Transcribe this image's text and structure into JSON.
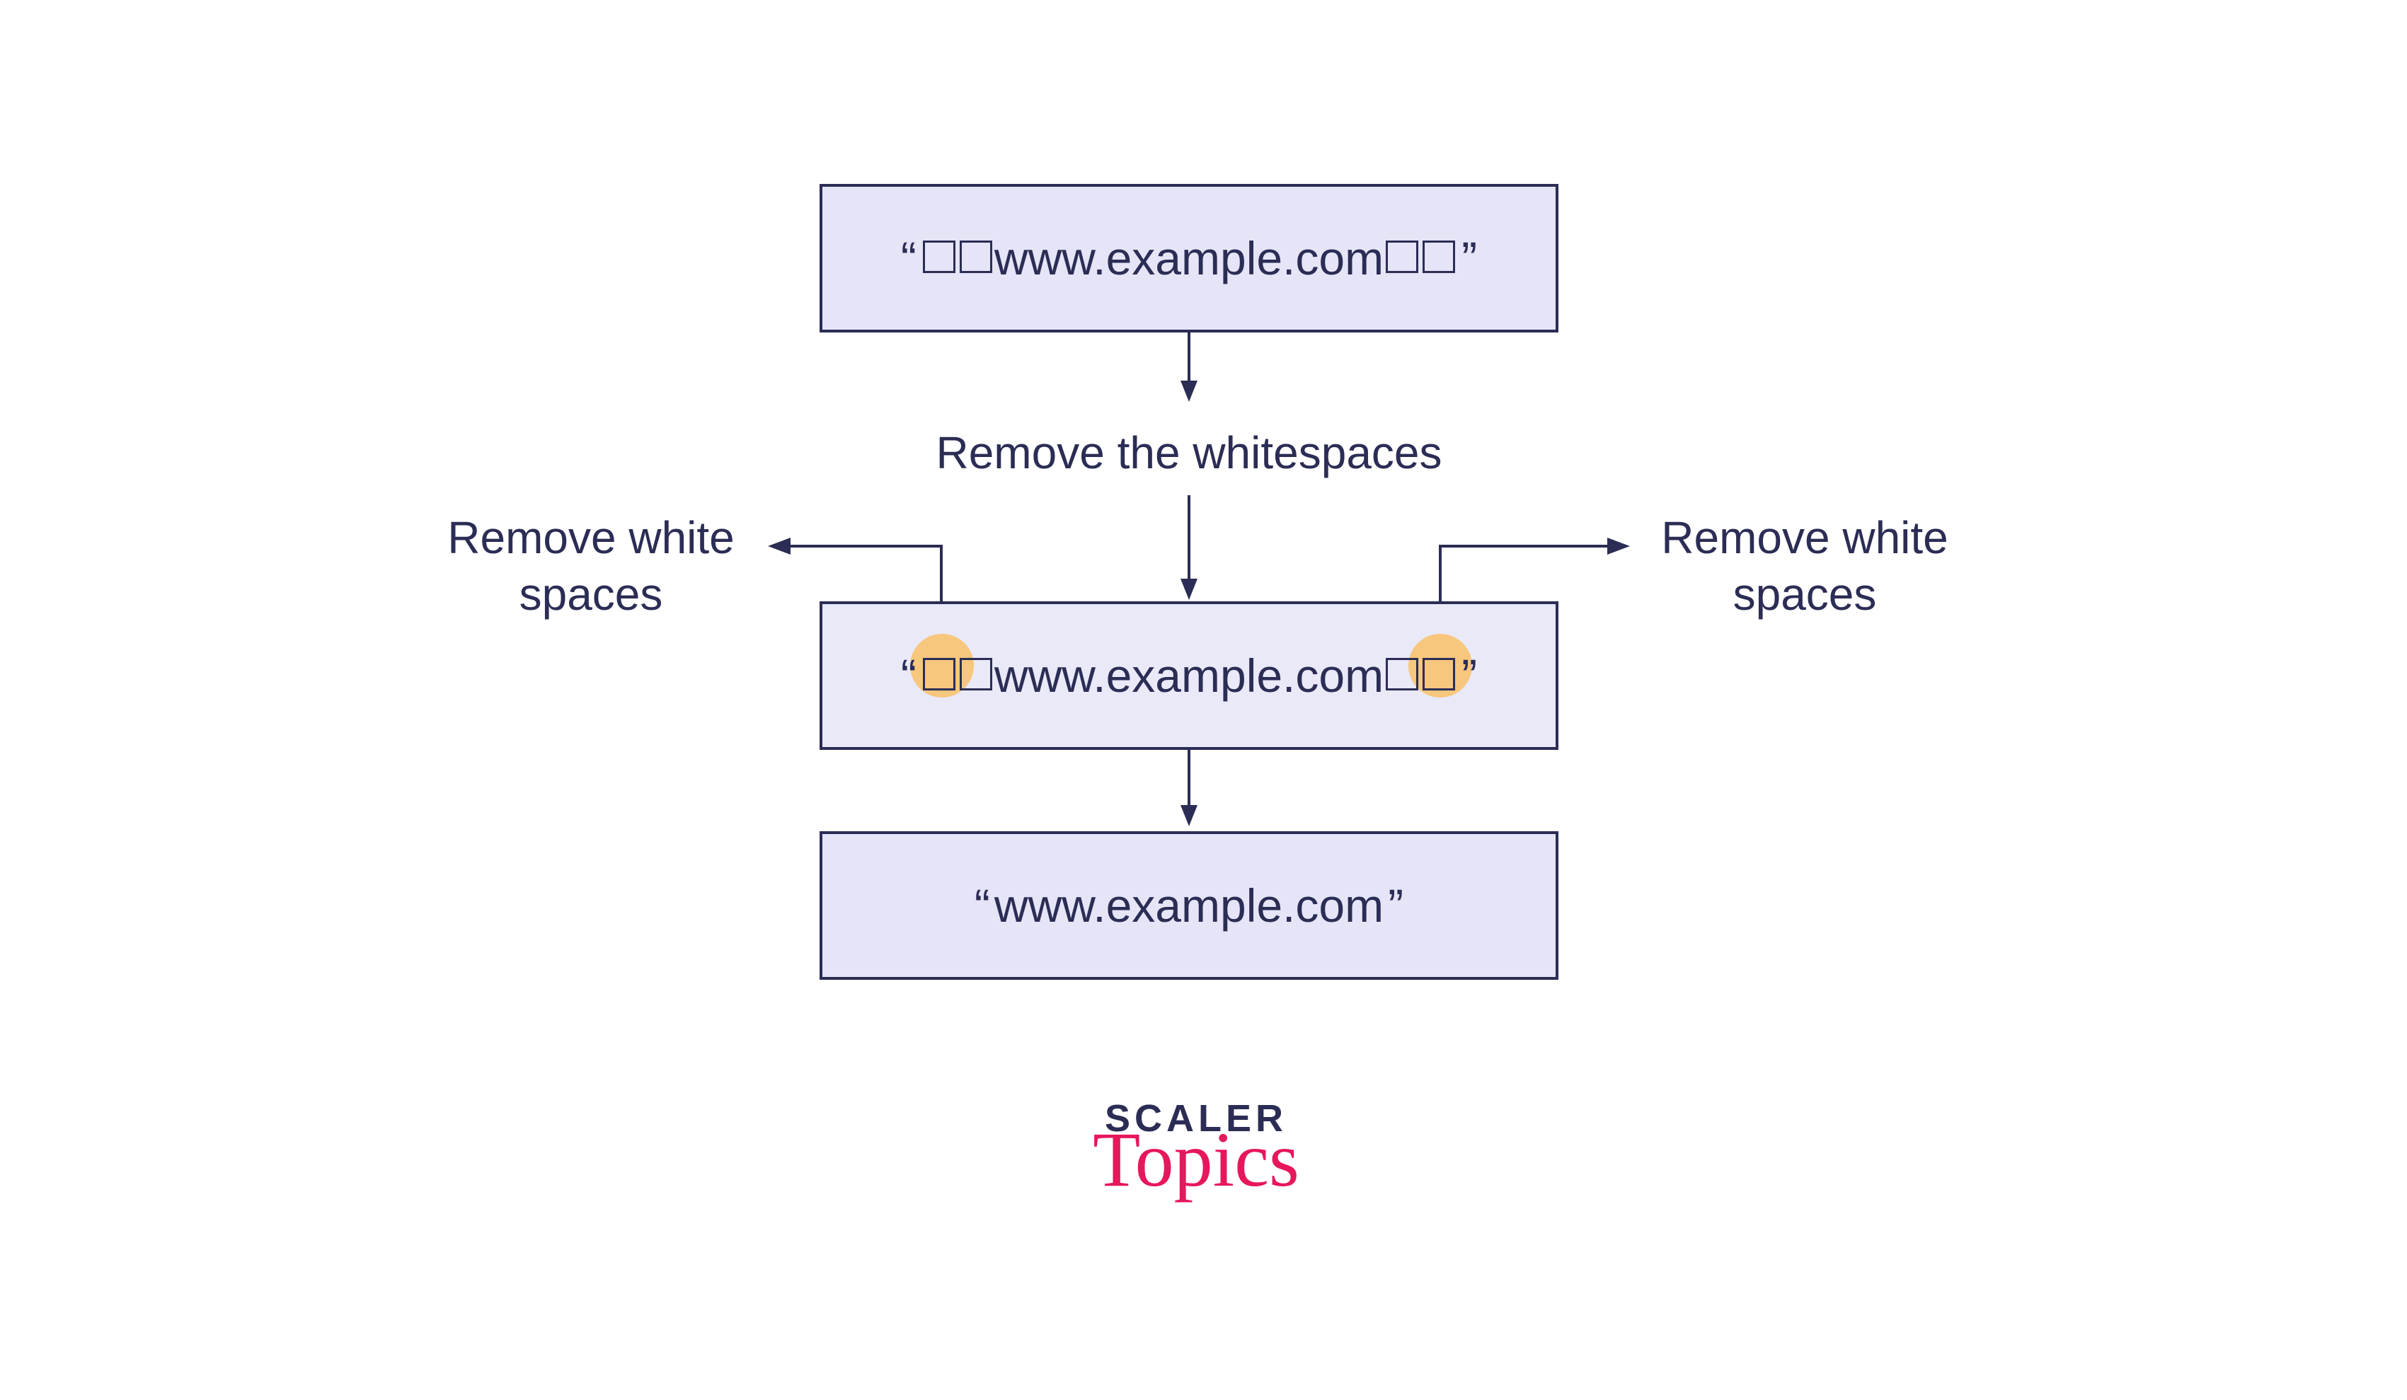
{
  "steps": {
    "input_text": "www.example.com",
    "middle_text": "www.example.com",
    "output_text": "www.example.com"
  },
  "labels": {
    "center": "Remove the whitespaces",
    "left_line1": "Remove white",
    "left_line2": "spaces",
    "right_line1": "Remove white",
    "right_line2": "spaces"
  },
  "glyphs": {
    "open_quote": "“",
    "close_quote": "”"
  },
  "logo": {
    "line1": "SCALER",
    "line2": "Topics"
  },
  "colors": {
    "box_fill": "#e5e5f7",
    "box_border": "#2b2d55",
    "text": "#2b2d55",
    "highlight": "#f7c77d",
    "accent": "#e6175b"
  }
}
